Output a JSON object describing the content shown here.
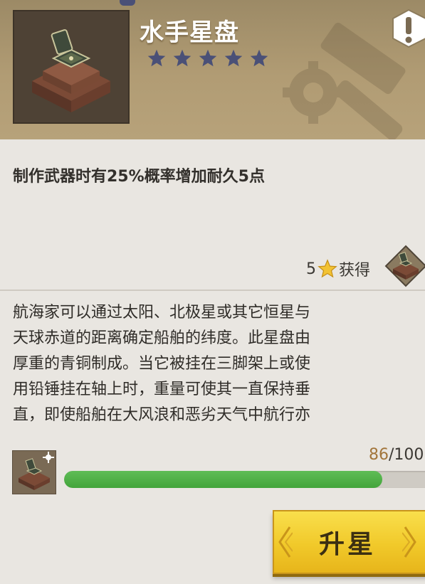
{
  "item": {
    "name": "水手星盘",
    "star_rating": 5,
    "icon": "astrolabe-icon"
  },
  "effect": "制作武器时有25%概率增加耐久5点",
  "acquire": {
    "star_count": "5",
    "label": "获得"
  },
  "lore_lines": [
    "航海家可以通过太阳、北极星或其它恒星与",
    "天球赤道的距离确定船舶的纬度。此星盘由",
    "厚重的青铜制成。当它被挂在三脚架上或使",
    "用铅锤挂在轴上时，重量可使其一直保持垂",
    "直，即使船舶在大风浪和恶劣天气中航行亦"
  ],
  "progress": {
    "current": "86",
    "separator_total": "/100",
    "fraction": 0.86
  },
  "upgrade_button": "升星",
  "colors": {
    "header": "#b19c74",
    "star": "#4a5077",
    "progress_fill": "#4bb042",
    "button": "#f1c92a"
  }
}
